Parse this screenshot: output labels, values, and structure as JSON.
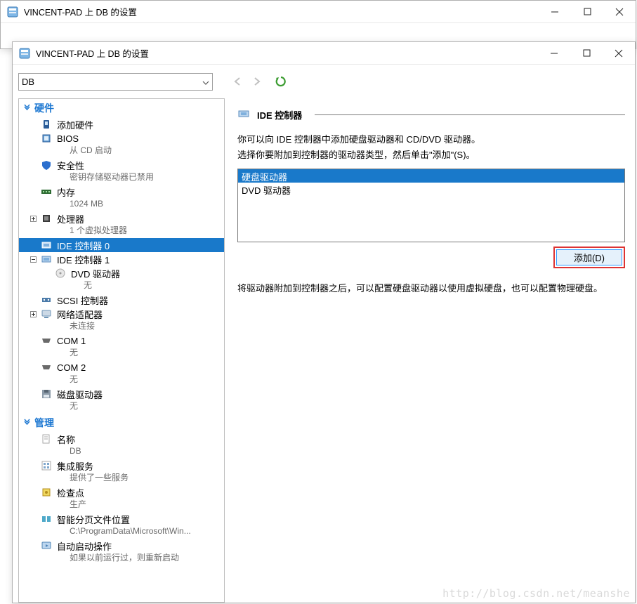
{
  "window_back": {
    "title": "VINCENT-PAD 上 DB 的设置"
  },
  "window": {
    "title": "VINCENT-PAD 上 DB 的设置"
  },
  "vm_selector": {
    "value": "DB"
  },
  "sidebar": {
    "groups": {
      "hardware": {
        "label": "硬件"
      },
      "management": {
        "label": "管理"
      }
    },
    "items": {
      "add_hw": {
        "label": "添加硬件",
        "sub": ""
      },
      "bios": {
        "label": "BIOS",
        "sub": "从 CD 启动"
      },
      "security": {
        "label": "安全性",
        "sub": "密钥存储驱动器已禁用"
      },
      "memory": {
        "label": "内存",
        "sub": "1024 MB"
      },
      "cpu": {
        "label": "处理器",
        "sub": "1 个虚拟处理器"
      },
      "ide0": {
        "label": "IDE 控制器 0",
        "sub": ""
      },
      "ide1": {
        "label": "IDE 控制器 1",
        "sub": ""
      },
      "dvd": {
        "label": "DVD 驱动器",
        "sub": "无"
      },
      "scsi": {
        "label": "SCSI 控制器",
        "sub": ""
      },
      "nic": {
        "label": "网络适配器",
        "sub": "未连接"
      },
      "com1": {
        "label": "COM 1",
        "sub": "无"
      },
      "com2": {
        "label": "COM 2",
        "sub": "无"
      },
      "floppy": {
        "label": "磁盘驱动器",
        "sub": "无"
      },
      "name": {
        "label": "名称",
        "sub": "DB"
      },
      "integ": {
        "label": "集成服务",
        "sub": "提供了一些服务"
      },
      "checkpoint": {
        "label": "检查点",
        "sub": "生产"
      },
      "pagefile": {
        "label": "智能分页文件位置",
        "sub": "C:\\ProgramData\\Microsoft\\Win..."
      },
      "autostart": {
        "label": "自动启动操作",
        "sub": "如果以前运行过，则重新启动"
      }
    }
  },
  "right": {
    "panel_title": "IDE 控制器",
    "desc_line1": "你可以向 IDE 控制器中添加硬盘驱动器和 CD/DVD 驱动器。",
    "desc_line2": "选择你要附加到控制器的驱动器类型，然后单击\"添加\"(S)。",
    "list": {
      "hdd": "硬盘驱动器",
      "dvd": "DVD 驱动器"
    },
    "add_btn": "添加(D)",
    "after": "将驱动器附加到控制器之后，可以配置硬盘驱动器以使用虚拟硬盘，也可以配置物理硬盘。"
  },
  "watermark": "http://blog.csdn.net/meanshe"
}
